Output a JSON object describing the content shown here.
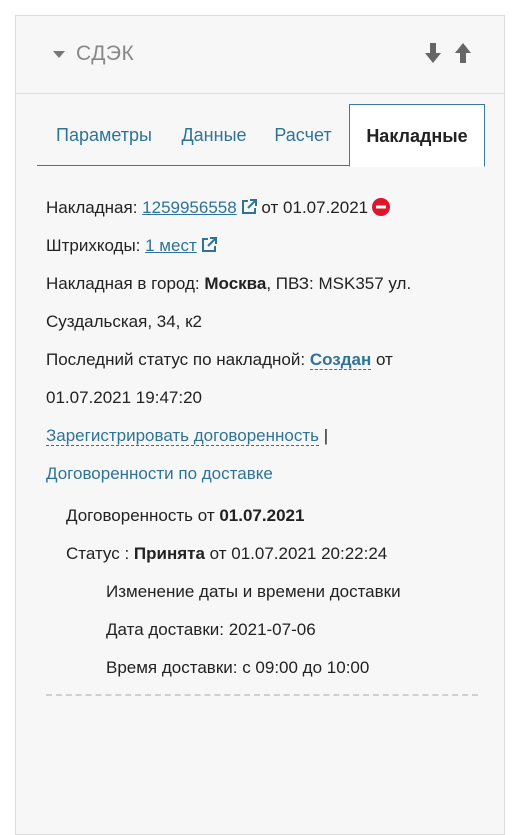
{
  "header": {
    "title": "СДЭК"
  },
  "tabs": [
    {
      "label": "Параметры"
    },
    {
      "label": "Данные"
    },
    {
      "label": "Расчет"
    },
    {
      "label": "Накладные"
    }
  ],
  "invoice": {
    "label": "Накладная: ",
    "number": "1259956558",
    "date_prefix": " от ",
    "date": "01.07.2021"
  },
  "barcodes": {
    "label": "Штрихкоды: ",
    "link": "1 мест"
  },
  "city": {
    "label": "Накладная в город: ",
    "name": "Москва",
    "pvz_text": ", ПВЗ: MSK357 ул.",
    "address_cont": "Суздальская, 34, к2"
  },
  "status": {
    "label": "Последний статус по накладной: ",
    "value": "Создан",
    "suffix": " от",
    "datetime": "01.07.2021 19:47:20"
  },
  "actions": {
    "register": "Зарегистрировать договоренность",
    "separator": " |",
    "agreements": "Договоренности по доставке"
  },
  "agreement": {
    "title_prefix": "Договоренность от ",
    "title_date": "01.07.2021",
    "status_label": "Статус : ",
    "status_value": "Принята",
    "status_suffix": " от 01.07.2021 20:22:24",
    "change_text": "Изменение даты и времени доставки",
    "delivery_date": "Дата доставки: 2021-07-06",
    "delivery_time": "Время доставки: с 09:00 до 10:00"
  },
  "colors": {
    "link": "#2e7398",
    "cancel": "#e0142a"
  },
  "icons": {
    "collapse": "triangle-down-icon",
    "sort_down": "arrow-down-icon",
    "sort_up": "arrow-up-icon",
    "external": "external-link-icon",
    "cancel": "minus-circle-icon"
  }
}
